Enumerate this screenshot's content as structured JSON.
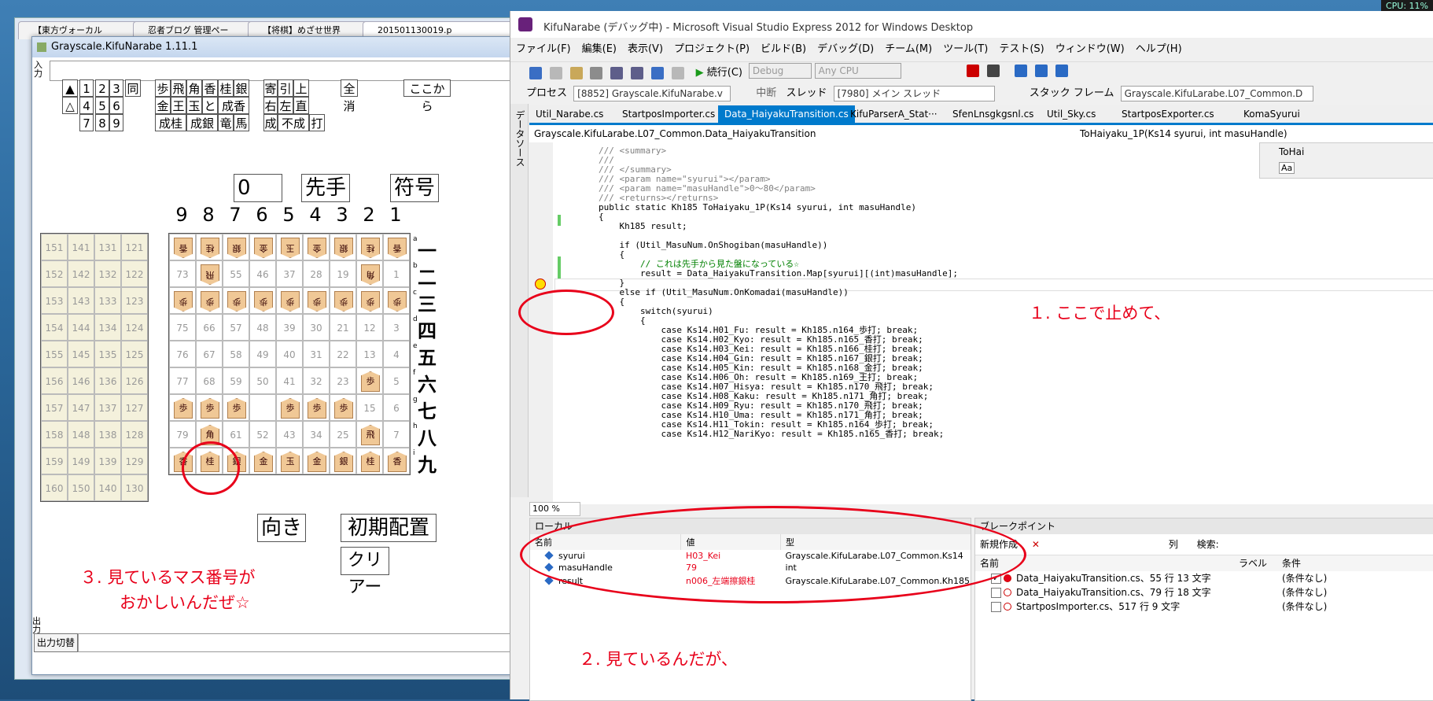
{
  "cpu": "CPU: 11%",
  "browser": {
    "tabs": [
      "【東方ヴォーカル",
      "忍者ブログ 管理ペー",
      "【将棋】めざせ世界",
      "20150113001​9.p"
    ]
  },
  "kifu": {
    "title": "Grayscale.KifuNarabe 1.11.1",
    "input_label": "入力",
    "buttons_row1": [
      "▲",
      "1",
      "2",
      "3",
      "同",
      "歩",
      "飛",
      "角",
      "香",
      "桂",
      "銀",
      "寄",
      "引",
      "上",
      "全消",
      "ここから"
    ],
    "buttons_row2": [
      "△",
      "4",
      "5",
      "6",
      "金",
      "王",
      "玉",
      "と",
      "成香",
      "右",
      "左",
      "直"
    ],
    "buttons_row3": [
      "7",
      "8",
      "9",
      "成桂",
      "成銀",
      "竜",
      "馬",
      "成",
      "不成",
      "打"
    ],
    "counter": "0",
    "turn": "先手",
    "notation": "符号",
    "files": [
      "9",
      "8",
      "7",
      "6",
      "5",
      "4",
      "3",
      "2",
      "1"
    ],
    "ranks": [
      "一",
      "二",
      "三",
      "四",
      "五",
      "六",
      "七",
      "八",
      "九"
    ],
    "ranks_small": [
      "a",
      "b",
      "c",
      "d",
      "e",
      "f",
      "g",
      "h",
      "i"
    ],
    "direction_button": "向き",
    "initial_button": "初期配置",
    "clear_button": "クリアー",
    "output_label": "出力",
    "output_switch": "出力切替"
  },
  "board": {
    "rows": [
      [
        "香",
        "桂",
        "銀",
        "金",
        "玉",
        "金",
        "銀",
        "桂",
        "香"
      ],
      [
        "73",
        "飛",
        "55",
        "46",
        "37",
        "28",
        "19",
        "角",
        "1"
      ],
      [
        "歩",
        "歩",
        "歩",
        "歩",
        "歩",
        "歩",
        "歩",
        "歩",
        "歩"
      ],
      [
        "75",
        "66",
        "57",
        "48",
        "39",
        "30",
        "21",
        "12",
        "3"
      ],
      [
        "76",
        "67",
        "58",
        "49",
        "40",
        "31",
        "22",
        "13",
        "4"
      ],
      [
        "77",
        "68",
        "59",
        "50",
        "41",
        "32",
        "23",
        "歩",
        "5"
      ],
      [
        "歩",
        "歩",
        "歩",
        "",
        "歩",
        "歩",
        "歩",
        "15",
        "6"
      ],
      [
        "79",
        "角",
        "61",
        "52",
        "43",
        "34",
        "25",
        "飛",
        "7"
      ],
      [
        "香",
        "桂",
        "銀",
        "金",
        "玉",
        "金",
        "銀",
        "桂",
        "香"
      ]
    ],
    "komadai": [
      [
        "151",
        "141",
        "131",
        "121"
      ],
      [
        "152",
        "142",
        "132",
        "122"
      ],
      [
        "153",
        "143",
        "133",
        "123"
      ],
      [
        "154",
        "144",
        "134",
        "124"
      ],
      [
        "155",
        "145",
        "135",
        "125"
      ],
      [
        "156",
        "146",
        "136",
        "126"
      ],
      [
        "157",
        "147",
        "137",
        "127"
      ],
      [
        "158",
        "148",
        "138",
        "128"
      ],
      [
        "159",
        "149",
        "139",
        "129"
      ],
      [
        "160",
        "150",
        "140",
        "130"
      ]
    ]
  },
  "vs": {
    "title": "KifuNarabe (デバッグ中) - Microsoft Visual Studio Express 2012 for Windows Desktop",
    "menu": [
      "ファイル(F)",
      "編集(E)",
      "表示(V)",
      "プロジェクト(P)",
      "ビルド(B)",
      "デバッグ(D)",
      "チーム(M)",
      "ツール(T)",
      "テスト(S)",
      "ウィンドウ(W)",
      "ヘルプ(H)"
    ],
    "continue_label": "続行(C)",
    "config": "Debug",
    "platform": "Any CPU",
    "process_label": "プロセス",
    "process_value": "[8852] Grayscale.KifuNarabe.v",
    "suspend_label": "中断",
    "thread_label": "スレッド",
    "thread_value": "[7980] メイン スレッド",
    "stackframe_label": "スタック フレーム",
    "stackframe_value": "Grayscale.KifuLarabe.L07_Common.D",
    "side_tab": "データソース",
    "doc_tabs": [
      "Util_Narabe.cs",
      "StartposImporter.cs",
      "Data_HaiyakuTransition.cs",
      "KifuParserA_Stat···",
      "SfenLnsgkgsnl.cs",
      "Util_Sky.cs",
      "StartposExporter.cs",
      "KomaSyurui"
    ],
    "nav_left": "Grayscale.KifuLarabe.L07_Common.Data_HaiyakuTransition",
    "nav_right": "ToHaiyaku_1P(Ks14 syurui, int masuHandle)",
    "zoom": "100 %",
    "find_label": "ToHai",
    "find_opt": "Aa"
  },
  "locals": {
    "title": "ローカル",
    "headers": [
      "名前",
      "値",
      "型"
    ],
    "rows": [
      {
        "name": "syurui",
        "value": "H03_Kei",
        "type": "Grayscale.KifuLarabe.L07_Common.Ks14"
      },
      {
        "name": "masuHandle",
        "value": "79",
        "type": "int"
      },
      {
        "name": "result",
        "value": "n006_左端擦銀桂",
        "type": "Grayscale.KifuLarabe.L07_Common.Kh185"
      }
    ]
  },
  "breakpoints": {
    "title": "ブレークポイント",
    "new_label": "新規作成",
    "columns_label": "列",
    "search_label": "検索:",
    "headers": [
      "名前",
      "ラベル",
      "条件"
    ],
    "rows": [
      {
        "name": "Data_HaiyakuTransition.cs、55 行 13 文字",
        "cond": "(条件なし)",
        "checked": true
      },
      {
        "name": "Data_HaiyakuTransition.cs、79 行 18 文字",
        "cond": "(条件なし)",
        "checked": false
      },
      {
        "name": "StartposImporter.cs、517 行 9 文字",
        "cond": "(条件なし)",
        "checked": false
      }
    ]
  },
  "annotations": {
    "a1": "１. ここで止めて、",
    "a2": "２. 見ているんだが、",
    "a3_line1": "３. 見ているマス番号が",
    "a3_line2": "おかしいんだぜ☆"
  },
  "code_lines": [
    "/// <summary>",
    "/// ",
    "/// </summary>",
    "/// <param name=\"syurui\"></param>",
    "/// <param name=\"masuHandle\">0～80</param>",
    "/// <returns></returns>",
    "public static Kh185 ToHaiyaku_1P(Ks14 syurui, int masuHandle)",
    "{",
    "    Kh185 result;",
    "",
    "    if (Util_MasuNum.OnShogiban(masuHandle))",
    "    {",
    "        // これは先手から見た盤になっている☆",
    "        result = Data_HaiyakuTransition.Map[syurui][(int)masuHandle];",
    "    }",
    "    else if (Util_MasuNum.OnKomadai(masuHandle))",
    "    {",
    "        switch(syurui)",
    "        {",
    "            case Ks14.H01_Fu: result = Kh185.n164_歩打; break;",
    "            case Ks14.H02_Kyo: result = Kh185.n165_香打; break;",
    "            case Ks14.H03_Kei: result = Kh185.n166_桂打; break;",
    "            case Ks14.H04_Gin: result = Kh185.n167_銀打; break;",
    "            case Ks14.H05_Kin: result = Kh185.n168_金打; break;",
    "            case Ks14.H06_Oh: result = Kh185.n169_王打; break;",
    "            case Ks14.H07_Hisya: result = Kh185.n170_飛打; break;",
    "            case Ks14.H08_Kaku: result = Kh185.n171_角打; break;",
    "            case Ks14.H09_Ryu: result = Kh185.n170_飛打; break;",
    "            case Ks14.H10_Uma: result = Kh185.n171_角打; break;",
    "            case Ks14.H11_Tokin: result = Kh185.n164_歩打; break;",
    "            case Ks14.H12_NariKyo: result = Kh185.n165_香打; break;"
  ]
}
